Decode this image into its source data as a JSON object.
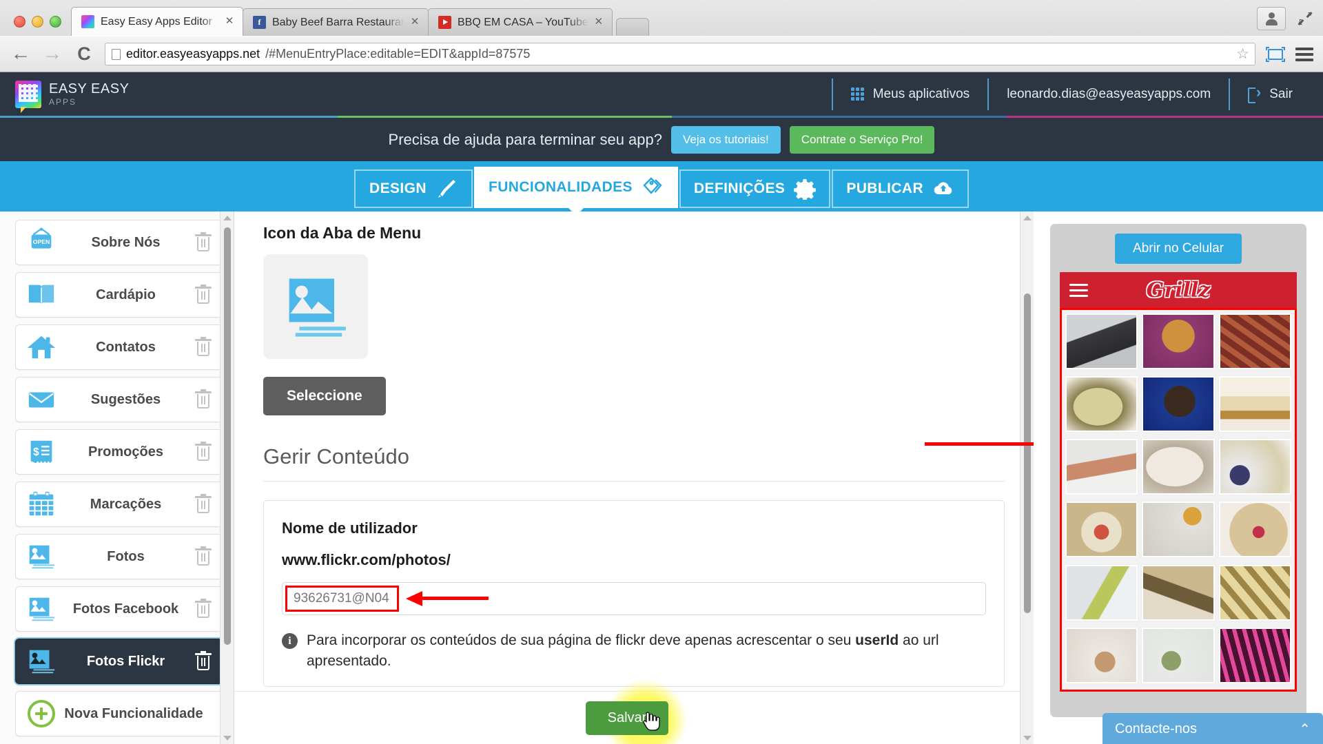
{
  "browser": {
    "tabs": [
      {
        "title": "Easy Easy Apps Editor",
        "favicon": "easy-apps-icon",
        "active": true
      },
      {
        "title": "Baby Beef Barra Restaurant",
        "favicon": "facebook-icon",
        "active": false
      },
      {
        "title": "BBQ EM CASA – YouTube",
        "favicon": "youtube-icon",
        "active": false
      }
    ],
    "close_label": "✕",
    "back_icon": "back-arrow-icon",
    "forward_icon": "forward-arrow-icon",
    "reload_icon": "reload-icon",
    "url_host": "editor.easyeasyapps.net",
    "url_path": "/#MenuEntryPlace:editable=EDIT&appId=87575",
    "star_icon": "bookmark-star-icon",
    "cast_icon": "cast-icon",
    "menu_icon": "hamburger-menu-icon",
    "profile_icon": "user-profile-icon",
    "fullscreen_icon": "fullscreen-icon"
  },
  "header": {
    "brand_line1": "EASY EASY",
    "brand_line2": "APPS",
    "my_apps": "Meus aplicativos",
    "account_email": "leonardo.dias@easyeasyapps.com",
    "logout": "Sair"
  },
  "promo": {
    "text": "Precisa de ajuda para terminar seu app?",
    "tutorials_btn": "Veja os tutoriais!",
    "pro_btn": "Contrate o Serviço Pro!"
  },
  "nav_tabs": [
    {
      "label": "DESIGN",
      "icon": "paintbrush-icon",
      "active": false
    },
    {
      "label": "FUNCIONALIDADES",
      "icon": "tags-icon",
      "active": true
    },
    {
      "label": "DEFINIÇÕES",
      "icon": "gear-icon",
      "active": false
    },
    {
      "label": "PUBLICAR",
      "icon": "cloud-upload-icon",
      "active": false
    }
  ],
  "sidebar": {
    "items": [
      {
        "label": "Sobre Nós",
        "icon": "open-sign-icon",
        "selected": false
      },
      {
        "label": "Cardápio",
        "icon": "book-icon",
        "selected": false
      },
      {
        "label": "Contatos",
        "icon": "home-icon",
        "selected": false
      },
      {
        "label": "Sugestões",
        "icon": "envelope-icon",
        "selected": false
      },
      {
        "label": "Promoções",
        "icon": "receipt-dollar-icon",
        "selected": false
      },
      {
        "label": "Marcações",
        "icon": "calendar-icon",
        "selected": false
      },
      {
        "label": "Fotos",
        "icon": "photos-stack-icon",
        "selected": false
      },
      {
        "label": "Fotos Facebook",
        "icon": "photos-stack-icon",
        "selected": false
      },
      {
        "label": "Fotos Flickr",
        "icon": "photos-stack-icon",
        "selected": true
      }
    ],
    "add_feature": "Nova Funcionalidade",
    "delete_icon": "trash-icon",
    "add_icon": "plus-circle-icon"
  },
  "main": {
    "icon_section_title": "Icon da Aba de Menu",
    "tab_icon": "photos-stack-icon",
    "select_btn": "Seleccione",
    "manage_title": "Gerir Conteúdo",
    "field_label": "Nome de utilizador",
    "field_url": "www.flickr.com/photos/",
    "field_value": "93626731@N04",
    "field_placeholder": "93626731@N04",
    "hint_icon": "info-icon",
    "hint_text_before": "Para incorporar os conteúdos de sua página de flickr deve apenas acrescentar o seu ",
    "hint_text_bold": "userId",
    "hint_text_after": " ao url apresentado.",
    "save_btn": "Salvar",
    "cursor": "pointer-hand-cursor"
  },
  "preview": {
    "open_mobile_btn": "Abrir no Celular",
    "app_name": "Grillz",
    "menu_icon": "hamburger-menu-icon",
    "contact_bar": "Contacte-nos",
    "contact_chevron": "chevron-up-icon",
    "thumbnails": [
      {
        "alt": "two dark drinks in glasses",
        "c1": "#3a3a3c",
        "c2": "#cfd2d4"
      },
      {
        "alt": "woman in gold headdress on purple",
        "c1": "#7a2b62",
        "c2": "#d0913f"
      },
      {
        "alt": "pile of brown sausages",
        "c1": "#7d2f24",
        "c2": "#b35a3d"
      },
      {
        "alt": "plate of rice salad",
        "c1": "#d6cf9a",
        "c2": "#8a7f4c"
      },
      {
        "alt": "person in dark mask on blue",
        "c1": "#14277a",
        "c2": "#3a2a20"
      },
      {
        "alt": "stack of pancakes with syrup",
        "c1": "#e7d6ae",
        "c2": "#b78a3f"
      },
      {
        "alt": "salmon fillet on white plate",
        "c1": "#e6e6e4",
        "c2": "#c98b6b"
      },
      {
        "alt": "white cloth napkin with cutlery",
        "c1": "#efe9e0",
        "c2": "#b9ad9b"
      },
      {
        "alt": "bowl of granola with blueberries",
        "c1": "#e9e9ea",
        "c2": "#3b3b6b"
      },
      {
        "alt": "ceramic bowl with fruit salad",
        "c1": "#cbb68c",
        "c2": "#d0533f"
      },
      {
        "alt": "table setting with dessert plates",
        "c1": "#e3e0dc",
        "c2": "#d9a23a"
      },
      {
        "alt": "cereal with raspberries and milk",
        "c1": "#d9c49a",
        "c2": "#c0304a"
      },
      {
        "alt": "small white bowls with olive oil",
        "c1": "#dfe3e6",
        "c2": "#b9c75c"
      },
      {
        "alt": "buffet table with food",
        "c1": "#cbb78e",
        "c2": "#6e5b3a"
      },
      {
        "alt": "cheese cubes on wooden board",
        "c1": "#e5d79d",
        "c2": "#9d8546"
      },
      {
        "alt": "cappuccino cup on saucer",
        "c1": "#ece7e2",
        "c2": "#c39a6f"
      },
      {
        "alt": "appetizer bowls on white table",
        "c1": "#e8eae8",
        "c2": "#8ea06a"
      },
      {
        "alt": "concert stage with pink lights",
        "c1": "#4a1130",
        "c2": "#e2489b"
      }
    ]
  }
}
